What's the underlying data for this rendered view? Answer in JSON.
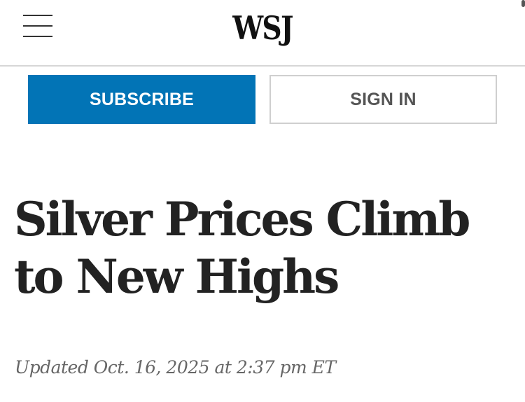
{
  "header": {
    "logo": "WSJ",
    "menu_icon": "hamburger-menu-icon"
  },
  "auth": {
    "subscribe_label": "SUBSCRIBE",
    "signin_label": "SIGN IN",
    "subscribe_color": "#0274b6"
  },
  "article": {
    "headline": "Silver Prices Climb to New Highs",
    "timestamp": "Updated Oct. 16, 2025 at 2:37 pm ET"
  }
}
